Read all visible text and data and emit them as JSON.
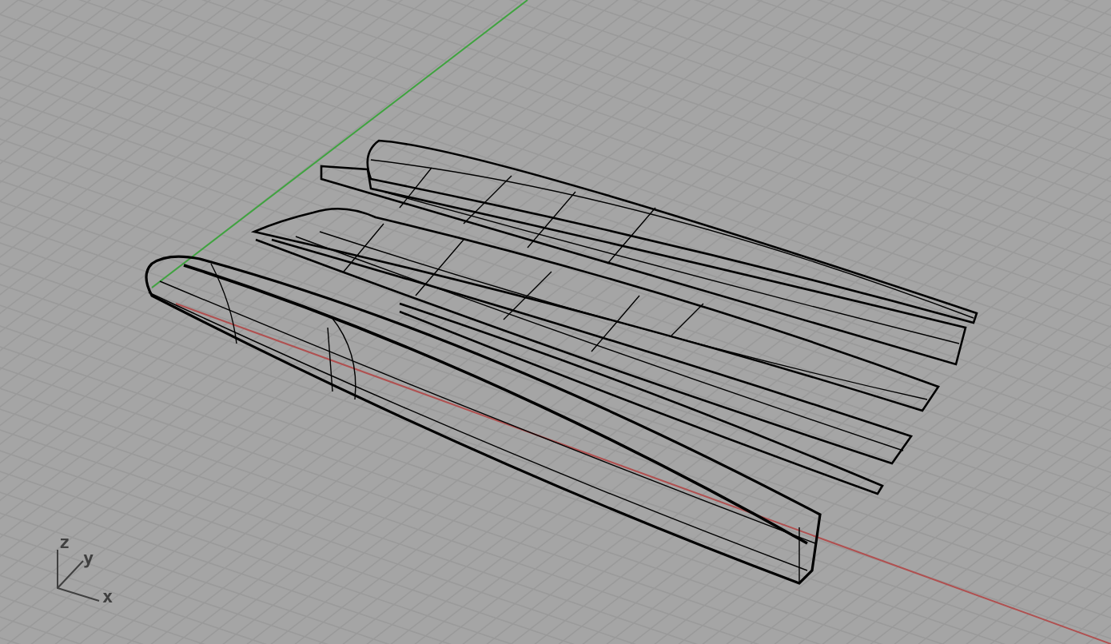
{
  "viewport": {
    "axis_labels": [
      "z",
      "y",
      "x"
    ]
  }
}
